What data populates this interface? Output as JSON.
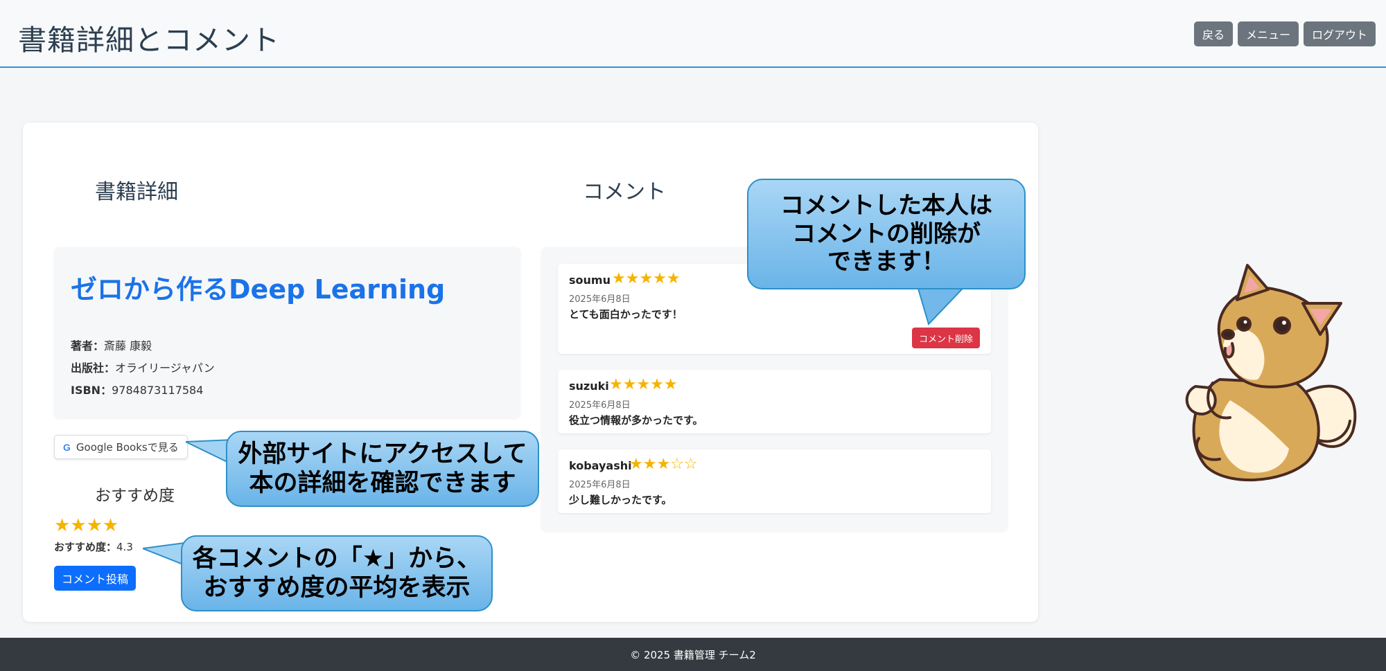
{
  "header": {
    "title": "書籍詳細とコメント",
    "buttons": {
      "back": "戻る",
      "menu": "メニュー",
      "logout": "ログアウト"
    }
  },
  "book_section": {
    "heading": "書籍詳細",
    "title": "ゼロから作るDeep Learning",
    "author_label": "著者：",
    "author": "斎藤 康毅",
    "publisher_label": "出版社：",
    "publisher": "オライリージャパン",
    "isbn_label": "ISBN：",
    "isbn": "9784873117584",
    "google_books_button": "Google Booksで見る",
    "google_icon_letter": "G"
  },
  "recommendation": {
    "heading": "おすすめ度",
    "stars": "★★★★",
    "score_label": "おすすめ度：",
    "score": "4.3",
    "post_button": "コメント投稿"
  },
  "comments_section": {
    "heading": "コメント",
    "comments": [
      {
        "user": "soumu",
        "stars": "★★★★★",
        "rating": 5,
        "date": "2025年6月8日",
        "text": "とても面白かったです！",
        "delete_button": "コメント削除"
      },
      {
        "user": "suzuki",
        "stars": "★★★★★",
        "rating": 5,
        "date": "2025年6月8日",
        "text": "役立つ情報が多かったです。"
      },
      {
        "user": "kobayashi",
        "stars": "★★★☆☆",
        "rating": 3,
        "date": "2025年6月8日",
        "text": "少し難しかったです。"
      }
    ]
  },
  "callouts": {
    "delete": [
      "コメントした本人は",
      "コメントの削除が",
      "できます！"
    ],
    "external": [
      "外部サイトにアクセスして",
      "本の詳細を確認できます"
    ],
    "average": [
      "各コメントの「★」から、",
      "おすすめ度の平均を表示"
    ]
  },
  "footer": {
    "text": "© 2025 書籍管理 チーム2"
  },
  "colors": {
    "accent": "#0d6efd",
    "book_title": "#1a73e8",
    "danger": "#dc3545",
    "star": "#f5b301",
    "nav_button": "#6c757d",
    "footer_bg": "#343a40",
    "callout_border": "#2b90c9"
  },
  "icons": {
    "mascot": "shiba-inu-mascot"
  }
}
